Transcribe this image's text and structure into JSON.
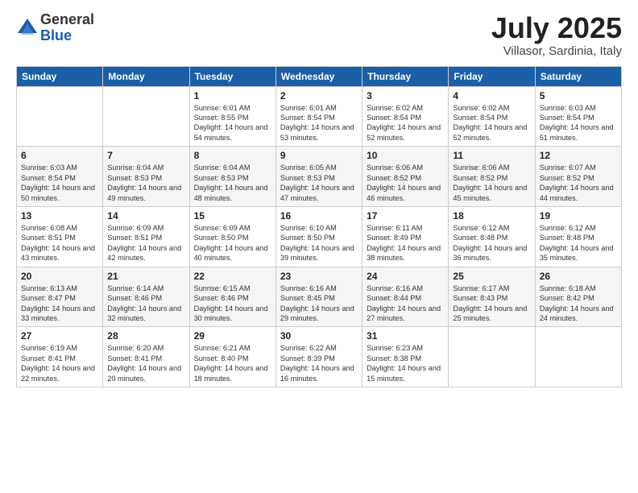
{
  "logo": {
    "general": "General",
    "blue": "Blue"
  },
  "title": {
    "month": "July 2025",
    "location": "Villasor, Sardinia, Italy"
  },
  "headers": [
    "Sunday",
    "Monday",
    "Tuesday",
    "Wednesday",
    "Thursday",
    "Friday",
    "Saturday"
  ],
  "weeks": [
    [
      {
        "day": "",
        "info": ""
      },
      {
        "day": "",
        "info": ""
      },
      {
        "day": "1",
        "info": "Sunrise: 6:01 AM\nSunset: 8:55 PM\nDaylight: 14 hours and 54 minutes."
      },
      {
        "day": "2",
        "info": "Sunrise: 6:01 AM\nSunset: 8:54 PM\nDaylight: 14 hours and 53 minutes."
      },
      {
        "day": "3",
        "info": "Sunrise: 6:02 AM\nSunset: 8:54 PM\nDaylight: 14 hours and 52 minutes."
      },
      {
        "day": "4",
        "info": "Sunrise: 6:02 AM\nSunset: 8:54 PM\nDaylight: 14 hours and 52 minutes."
      },
      {
        "day": "5",
        "info": "Sunrise: 6:03 AM\nSunset: 8:54 PM\nDaylight: 14 hours and 51 minutes."
      }
    ],
    [
      {
        "day": "6",
        "info": "Sunrise: 6:03 AM\nSunset: 8:54 PM\nDaylight: 14 hours and 50 minutes."
      },
      {
        "day": "7",
        "info": "Sunrise: 6:04 AM\nSunset: 8:53 PM\nDaylight: 14 hours and 49 minutes."
      },
      {
        "day": "8",
        "info": "Sunrise: 6:04 AM\nSunset: 8:53 PM\nDaylight: 14 hours and 48 minutes."
      },
      {
        "day": "9",
        "info": "Sunrise: 6:05 AM\nSunset: 8:53 PM\nDaylight: 14 hours and 47 minutes."
      },
      {
        "day": "10",
        "info": "Sunrise: 6:06 AM\nSunset: 8:52 PM\nDaylight: 14 hours and 46 minutes."
      },
      {
        "day": "11",
        "info": "Sunrise: 6:06 AM\nSunset: 8:52 PM\nDaylight: 14 hours and 45 minutes."
      },
      {
        "day": "12",
        "info": "Sunrise: 6:07 AM\nSunset: 8:52 PM\nDaylight: 14 hours and 44 minutes."
      }
    ],
    [
      {
        "day": "13",
        "info": "Sunrise: 6:08 AM\nSunset: 8:51 PM\nDaylight: 14 hours and 43 minutes."
      },
      {
        "day": "14",
        "info": "Sunrise: 6:09 AM\nSunset: 8:51 PM\nDaylight: 14 hours and 42 minutes."
      },
      {
        "day": "15",
        "info": "Sunrise: 6:09 AM\nSunset: 8:50 PM\nDaylight: 14 hours and 40 minutes."
      },
      {
        "day": "16",
        "info": "Sunrise: 6:10 AM\nSunset: 8:50 PM\nDaylight: 14 hours and 39 minutes."
      },
      {
        "day": "17",
        "info": "Sunrise: 6:11 AM\nSunset: 8:49 PM\nDaylight: 14 hours and 38 minutes."
      },
      {
        "day": "18",
        "info": "Sunrise: 6:12 AM\nSunset: 8:48 PM\nDaylight: 14 hours and 36 minutes."
      },
      {
        "day": "19",
        "info": "Sunrise: 6:12 AM\nSunset: 8:48 PM\nDaylight: 14 hours and 35 minutes."
      }
    ],
    [
      {
        "day": "20",
        "info": "Sunrise: 6:13 AM\nSunset: 8:47 PM\nDaylight: 14 hours and 33 minutes."
      },
      {
        "day": "21",
        "info": "Sunrise: 6:14 AM\nSunset: 8:46 PM\nDaylight: 14 hours and 32 minutes."
      },
      {
        "day": "22",
        "info": "Sunrise: 6:15 AM\nSunset: 8:46 PM\nDaylight: 14 hours and 30 minutes."
      },
      {
        "day": "23",
        "info": "Sunrise: 6:16 AM\nSunset: 8:45 PM\nDaylight: 14 hours and 29 minutes."
      },
      {
        "day": "24",
        "info": "Sunrise: 6:16 AM\nSunset: 8:44 PM\nDaylight: 14 hours and 27 minutes."
      },
      {
        "day": "25",
        "info": "Sunrise: 6:17 AM\nSunset: 8:43 PM\nDaylight: 14 hours and 25 minutes."
      },
      {
        "day": "26",
        "info": "Sunrise: 6:18 AM\nSunset: 8:42 PM\nDaylight: 14 hours and 24 minutes."
      }
    ],
    [
      {
        "day": "27",
        "info": "Sunrise: 6:19 AM\nSunset: 8:41 PM\nDaylight: 14 hours and 22 minutes."
      },
      {
        "day": "28",
        "info": "Sunrise: 6:20 AM\nSunset: 8:41 PM\nDaylight: 14 hours and 20 minutes."
      },
      {
        "day": "29",
        "info": "Sunrise: 6:21 AM\nSunset: 8:40 PM\nDaylight: 14 hours and 18 minutes."
      },
      {
        "day": "30",
        "info": "Sunrise: 6:22 AM\nSunset: 8:39 PM\nDaylight: 14 hours and 16 minutes."
      },
      {
        "day": "31",
        "info": "Sunrise: 6:23 AM\nSunset: 8:38 PM\nDaylight: 14 hours and 15 minutes."
      },
      {
        "day": "",
        "info": ""
      },
      {
        "day": "",
        "info": ""
      }
    ]
  ]
}
